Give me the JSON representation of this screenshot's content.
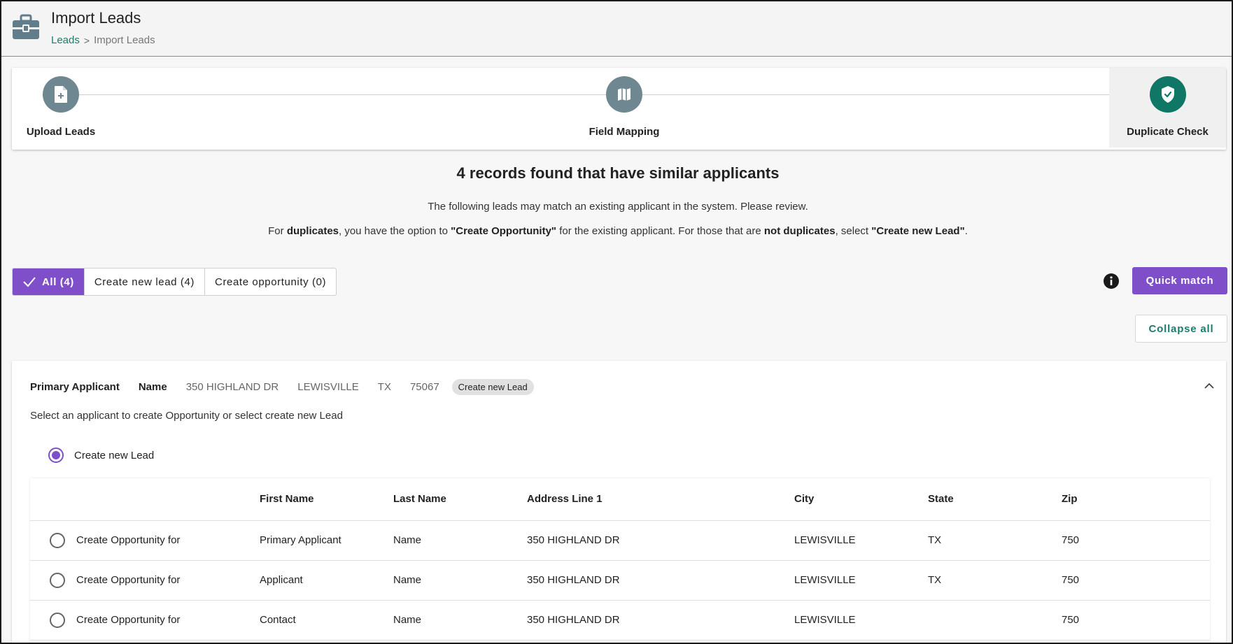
{
  "header": {
    "title": "Import Leads",
    "icon": "briefcase-icon",
    "breadcrumb": {
      "link": "Leads",
      "separator": ">",
      "current": "Import Leads"
    }
  },
  "stepper": {
    "steps": [
      {
        "label": "Upload Leads",
        "icon": "file-plus-icon",
        "state": "done"
      },
      {
        "label": "Field Mapping",
        "icon": "map-icon",
        "state": "done"
      },
      {
        "label": "Duplicate Check",
        "icon": "shield-check-icon",
        "state": "active"
      }
    ]
  },
  "summary": {
    "title": "4 records found that have similar applicants",
    "description": "The following leads may match an existing applicant in the system. Please review.",
    "instruction": {
      "p1": "For ",
      "b1": "duplicates",
      "p2": ", you have the option to ",
      "b2": "\"Create Opportunity\"",
      "p3": " for the existing applicant. For those that are ",
      "b3": "not duplicates",
      "p4": ", select ",
      "b4": "\"Create new Lead\"",
      "p5": "."
    }
  },
  "filters": [
    {
      "label": "All (4)",
      "selected": true
    },
    {
      "label": "Create new lead (4)",
      "selected": false
    },
    {
      "label": "Create opportunity (0)",
      "selected": false
    }
  ],
  "actions": {
    "quick_match": "Quick match",
    "collapse_all": "Collapse all"
  },
  "record": {
    "first_name": "Primary Applicant",
    "last_name": "Name",
    "address": "350 HIGHLAND DR",
    "city": "LEWISVILLE",
    "state": "TX",
    "zip": "75067",
    "status_chip": "Create new Lead",
    "select_message": "Select an applicant to create Opportunity or select create new Lead",
    "create_new_lead_option": "Create new Lead"
  },
  "table": {
    "columns": [
      "",
      "First Name",
      "Last Name",
      "Address Line 1",
      "City",
      "State",
      "Zip"
    ],
    "rows": [
      {
        "action": "Create Opportunity for",
        "first": "Primary Applicant",
        "last": "Name",
        "address": "350 HIGHLAND DR",
        "city": "LEWISVILLE",
        "state": "TX",
        "zip": "750"
      },
      {
        "action": "Create Opportunity for",
        "first": "Applicant",
        "last": "Name",
        "address": "350 HIGHLAND DR",
        "city": "LEWISVILLE",
        "state": "TX",
        "zip": "750"
      },
      {
        "action": "Create Opportunity for",
        "first": "Contact",
        "last": "Name",
        "address": "350 HIGHLAND DR",
        "city": "LEWISVILLE",
        "state": "",
        "zip": "750"
      }
    ]
  },
  "colors": {
    "accent": "#7e4fc9",
    "teal": "#1b7d6d",
    "step_done": "#6f8791",
    "step_active": "#0e7766"
  }
}
